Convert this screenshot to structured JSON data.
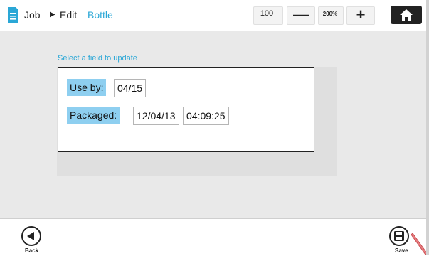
{
  "breadcrumb": {
    "job": "Job",
    "edit": "Edit",
    "item": "Bottle"
  },
  "toolbar": {
    "value": "100",
    "minus_label": "—",
    "zoom_level": "200%",
    "plus_label": "+"
  },
  "form": {
    "prompt": "Select a field to update",
    "use_by_label": "Use by:",
    "use_by_value": "04/15",
    "packaged_label": "Packaged:",
    "packaged_date": "12/04/13",
    "packaged_time": "04:09:25"
  },
  "footer": {
    "back_label": "Back",
    "save_label": "Save"
  },
  "colors": {
    "accent": "#2aa7d6",
    "label_highlight": "#8ecff0",
    "home_button": "#222222"
  },
  "icons": {
    "doc": "document-icon",
    "arrow": "triangle-right-icon",
    "home": "home-icon",
    "back": "back-arrow-icon",
    "save": "floppy-disk-icon",
    "pen": "stylus-icon"
  }
}
